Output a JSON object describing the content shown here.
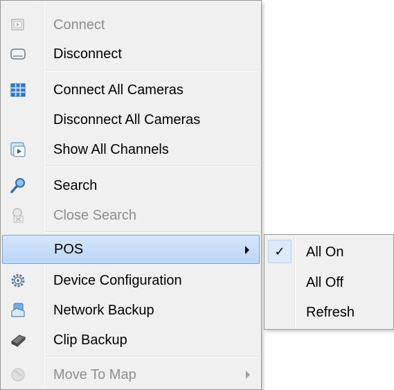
{
  "main_menu": {
    "items": [
      {
        "label": "Connect",
        "icon": "connect-icon",
        "enabled": false
      },
      {
        "label": "Disconnect",
        "icon": "disconnect-icon",
        "enabled": true
      },
      {
        "label": "Connect All Cameras",
        "icon": "grid-icon",
        "enabled": true
      },
      {
        "label": "Disconnect All Cameras",
        "icon": "",
        "enabled": true
      },
      {
        "label": "Show All Channels",
        "icon": "channels-icon",
        "enabled": true
      },
      {
        "label": "Search",
        "icon": "search-icon",
        "enabled": true
      },
      {
        "label": "Close Search",
        "icon": "close-search-icon",
        "enabled": false
      },
      {
        "label": "POS",
        "icon": "",
        "enabled": true,
        "highlighted": true,
        "has_submenu": true
      },
      {
        "label": "Device Configuration",
        "icon": "gear-icon",
        "enabled": true
      },
      {
        "label": "Network Backup",
        "icon": "network-backup-icon",
        "enabled": true
      },
      {
        "label": "Clip Backup",
        "icon": "clip-backup-icon",
        "enabled": true
      },
      {
        "label": "Move To Map",
        "icon": "map-icon",
        "enabled": false,
        "has_submenu": true
      }
    ]
  },
  "pos_submenu": {
    "items": [
      {
        "label": "All On",
        "checked": true
      },
      {
        "label": "All Off",
        "checked": false
      },
      {
        "label": "Refresh",
        "checked": false
      }
    ],
    "check_glyph": "✓"
  },
  "colors": {
    "menu_bg": "#f0f0f0",
    "highlight": "#c9def8",
    "highlight_border": "#7da2ce",
    "disabled_text": "#8d8d8d"
  }
}
